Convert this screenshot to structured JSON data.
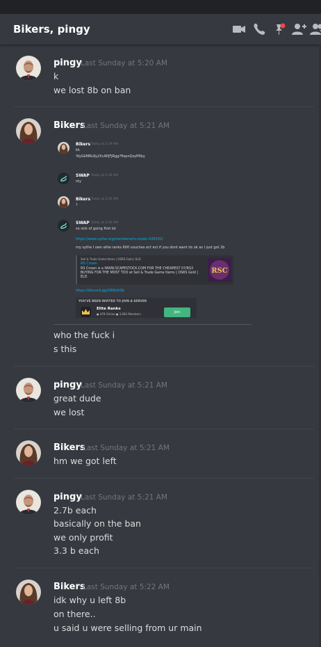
{
  "header": {
    "title": "Bikers, pingy"
  },
  "icons": {
    "video": "video-camera-icon",
    "call": "phone-icon",
    "pins": "pin-icon",
    "add_member": "add-member-icon",
    "members": "members-icon",
    "pin_badge_color": "#f04747"
  },
  "messages": [
    {
      "author": "pingy",
      "timestamp": "Last Sunday at 5:20 AM",
      "lines": [
        "k",
        "we lost 8b on ban"
      ]
    },
    {
      "author": "Bikers",
      "timestamp": "Last Sunday at 5:21 AM",
      "lines": [
        "who the fuck i",
        "s this"
      ]
    },
    {
      "author": "pingy",
      "timestamp": "Last Sunday at 5:21 AM",
      "lines": [
        "great dude",
        "we lost"
      ]
    },
    {
      "author": "Bikers",
      "timestamp": "Last Sunday at 5:21 AM",
      "lines": [
        "hm we got left"
      ]
    },
    {
      "author": "pingy",
      "timestamp": "Last Sunday at 5:21 AM",
      "lines": [
        "2.7b each",
        "basically on the ban",
        "we only profit",
        "3.3 b each"
      ]
    },
    {
      "author": "Bikers",
      "timestamp": "Last Sunday at 5:22 AM",
      "lines": [
        "idk why u left 8b",
        "on there..",
        "u said u were selling from ur main"
      ]
    }
  ],
  "embedded_screenshot": {
    "messages": [
      {
        "author": "Bikers",
        "timestamp": "Today at 2:19 AM",
        "lines": [
          "kk",
          "!KyGkMRLKy2XcAPjFJRgg?flopnQzyPRby"
        ]
      },
      {
        "author": "SWAP",
        "timestamp": "Today at 2:19 AM",
        "lines": [
          "nty"
        ]
      },
      {
        "author": "Bikers",
        "timestamp": "Today at 2:20 AM",
        "lines": [
          "?"
        ]
      },
      {
        "author": "SWAP",
        "timestamp": "Today at 2:20 AM",
        "lines": [
          "so sick of going first lol"
        ]
      }
    ],
    "link1": "https://www.sythe.org/members/rs-crown.435032/",
    "text1": "my sythe I own elite ranks 600 vouches ect ect if you dont want its ok as I just got 2b",
    "rich_embed": {
      "provider": "Sell & Trade Game Items | OSRS Gold | ELD",
      "title": "RS Crown",
      "description": "RS Crown is a WWW.SCAPESTOCK.COM FOR THE CHEAPEST 07/RS3 BUYING FOR THE MOST TOO at Sell & Trade Game Items | OSRS Gold | ELD",
      "thumb_text": "RSC"
    },
    "link2": "https://discord.gg/X9Wx5Qk",
    "invite": {
      "heading": "YOU'VE BEEN INVITED TO JOIN A SERVER",
      "server_name": "Elite Ranks",
      "stats": "● 478 Online  ● 3,983 Members",
      "button_label": "Join"
    }
  }
}
